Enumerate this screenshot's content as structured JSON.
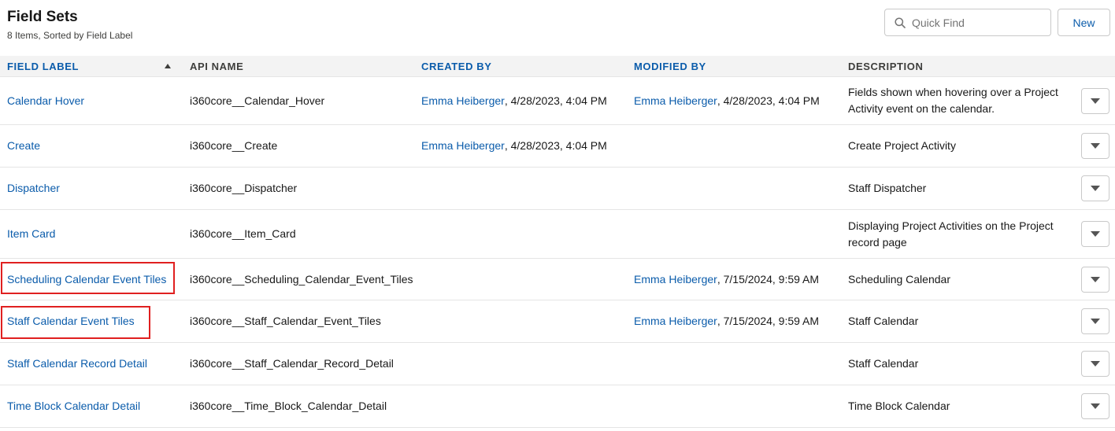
{
  "header": {
    "title": "Field Sets",
    "subtitle": "8 Items, Sorted by Field Label",
    "search_placeholder": "Quick Find",
    "new_label": "New"
  },
  "columns": {
    "field_label": "FIELD LABEL",
    "api_name": "API NAME",
    "created_by": "CREATED BY",
    "modified_by": "MODIFIED BY",
    "description": "DESCRIPTION"
  },
  "rows": [
    {
      "label": "Calendar Hover",
      "api": "i360core__Calendar_Hover",
      "created_user": "Emma Heiberger",
      "created_date": ", 4/28/2023, 4:04 PM",
      "modified_user": "Emma Heiberger",
      "modified_date": ", 4/28/2023, 4:04 PM",
      "description": "Fields shown when hovering over a Project Activity event on the calendar."
    },
    {
      "label": "Create",
      "api": "i360core__Create",
      "created_user": "Emma Heiberger",
      "created_date": ", 4/28/2023, 4:04 PM",
      "modified_user": "",
      "modified_date": "",
      "description": "Create Project Activity"
    },
    {
      "label": "Dispatcher",
      "api": "i360core__Dispatcher",
      "created_user": "",
      "created_date": "",
      "modified_user": "",
      "modified_date": "",
      "description": "Staff Dispatcher"
    },
    {
      "label": "Item Card",
      "api": "i360core__Item_Card",
      "created_user": "",
      "created_date": "",
      "modified_user": "",
      "modified_date": "",
      "description": "Displaying Project Activities on the Project record page"
    },
    {
      "label": "Scheduling Calendar Event Tiles",
      "api": "i360core__Scheduling_Calendar_Event_Tiles",
      "created_user": "",
      "created_date": "",
      "modified_user": "Emma Heiberger",
      "modified_date": ", 7/15/2024, 9:59 AM",
      "description": "Scheduling Calendar"
    },
    {
      "label": "Staff Calendar Event Tiles",
      "api": "i360core__Staff_Calendar_Event_Tiles",
      "created_user": "",
      "created_date": "",
      "modified_user": "Emma Heiberger",
      "modified_date": ", 7/15/2024, 9:59 AM",
      "description": "Staff Calendar"
    },
    {
      "label": "Staff Calendar Record Detail",
      "api": "i360core__Staff_Calendar_Record_Detail",
      "created_user": "",
      "created_date": "",
      "modified_user": "",
      "modified_date": "",
      "description": "Staff Calendar"
    },
    {
      "label": "Time Block Calendar Detail",
      "api": "i360core__Time_Block_Calendar_Detail",
      "created_user": "",
      "created_date": "",
      "modified_user": "",
      "modified_date": "",
      "description": "Time Block Calendar"
    }
  ],
  "icons": {
    "search": "search-icon",
    "sort": "sort-ascending-icon",
    "row_action": "chevron-down-icon"
  },
  "colors": {
    "link": "#0b5cab",
    "header_bg": "#f3f3f3",
    "highlight": "#e02020"
  }
}
